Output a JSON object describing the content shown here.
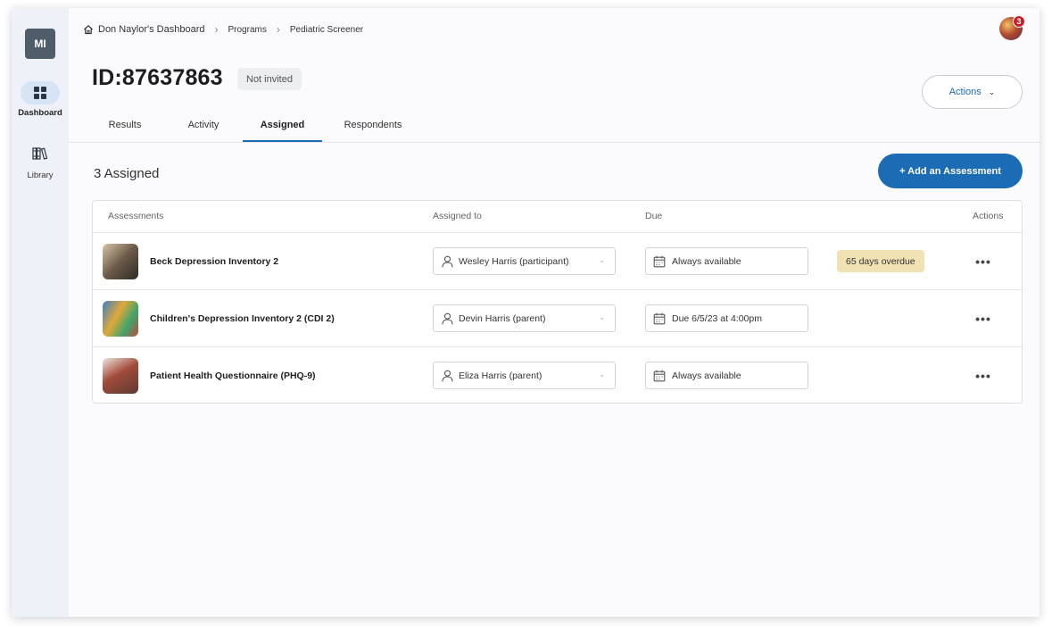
{
  "sidebar": {
    "org_initials": "MI",
    "items": [
      {
        "label": "Dashboard",
        "icon": "dashboard-grid-icon"
      },
      {
        "label": "Library",
        "icon": "library-books-icon"
      }
    ]
  },
  "breadcrumb": [
    "Don Naylor's Dashboard",
    "Programs",
    "Pediatric Screener"
  ],
  "user": {
    "notification_count": "3"
  },
  "header": {
    "title": "ID:87637863",
    "status": "Not invited",
    "actions_label": "Actions"
  },
  "tabs": [
    "Results",
    "Activity",
    "Assigned",
    "Respondents"
  ],
  "active_tab": "Assigned",
  "assigned": {
    "count_title": "3 Assigned",
    "add_button": "+ Add an Assessment",
    "columns": [
      "Assessments",
      "Assigned to",
      "Due",
      "Actions"
    ],
    "rows": [
      {
        "name": "Beck Depression Inventory 2",
        "assigned_to": "Wesley Harris (participant)",
        "due": "Always available",
        "badge": "65 days overdue"
      },
      {
        "name": "Children's Depression Inventory 2 (CDI 2)",
        "assigned_to": "Devin Harris (parent)",
        "due": "Due 6/5/23 at 4:00pm",
        "badge": ""
      },
      {
        "name": "Patient Health Questionnaire (PHQ-9)",
        "assigned_to": "Eliza Harris (parent)",
        "due": "Always available",
        "badge": ""
      }
    ],
    "more_label": "•••"
  },
  "colors": {
    "accent": "#1b6bb5",
    "overdue_bg": "#f1e2b4",
    "notification_badge": "#c91f2b",
    "sidebar_bg": "#eef2f8"
  }
}
